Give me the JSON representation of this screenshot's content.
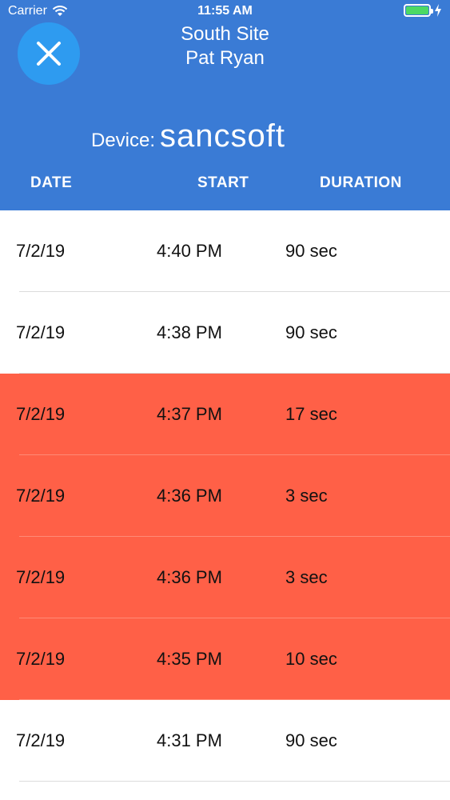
{
  "status_bar": {
    "carrier": "Carrier",
    "time": "11:55 AM",
    "battery_color": "#4cd964"
  },
  "header": {
    "background": "#3a7bd5",
    "close_icon": "close-icon",
    "site": "South Site",
    "user": "Pat Ryan",
    "device_label": "Device:",
    "device_name": "sancsoft"
  },
  "columns": {
    "date": "DATE",
    "start": "START",
    "duration": "DURATION"
  },
  "alert_color": "#ff6047",
  "rows": [
    {
      "date": "7/2/19",
      "start": "4:40 PM",
      "duration": "90 sec",
      "alert": false
    },
    {
      "date": "7/2/19",
      "start": "4:38 PM",
      "duration": "90 sec",
      "alert": false
    },
    {
      "date": "7/2/19",
      "start": "4:37 PM",
      "duration": "17 sec",
      "alert": true
    },
    {
      "date": "7/2/19",
      "start": "4:36 PM",
      "duration": "3 sec",
      "alert": true
    },
    {
      "date": "7/2/19",
      "start": "4:36 PM",
      "duration": "3 sec",
      "alert": true
    },
    {
      "date": "7/2/19",
      "start": "4:35 PM",
      "duration": "10 sec",
      "alert": true
    },
    {
      "date": "7/2/19",
      "start": "4:31 PM",
      "duration": "90 sec",
      "alert": false
    }
  ]
}
